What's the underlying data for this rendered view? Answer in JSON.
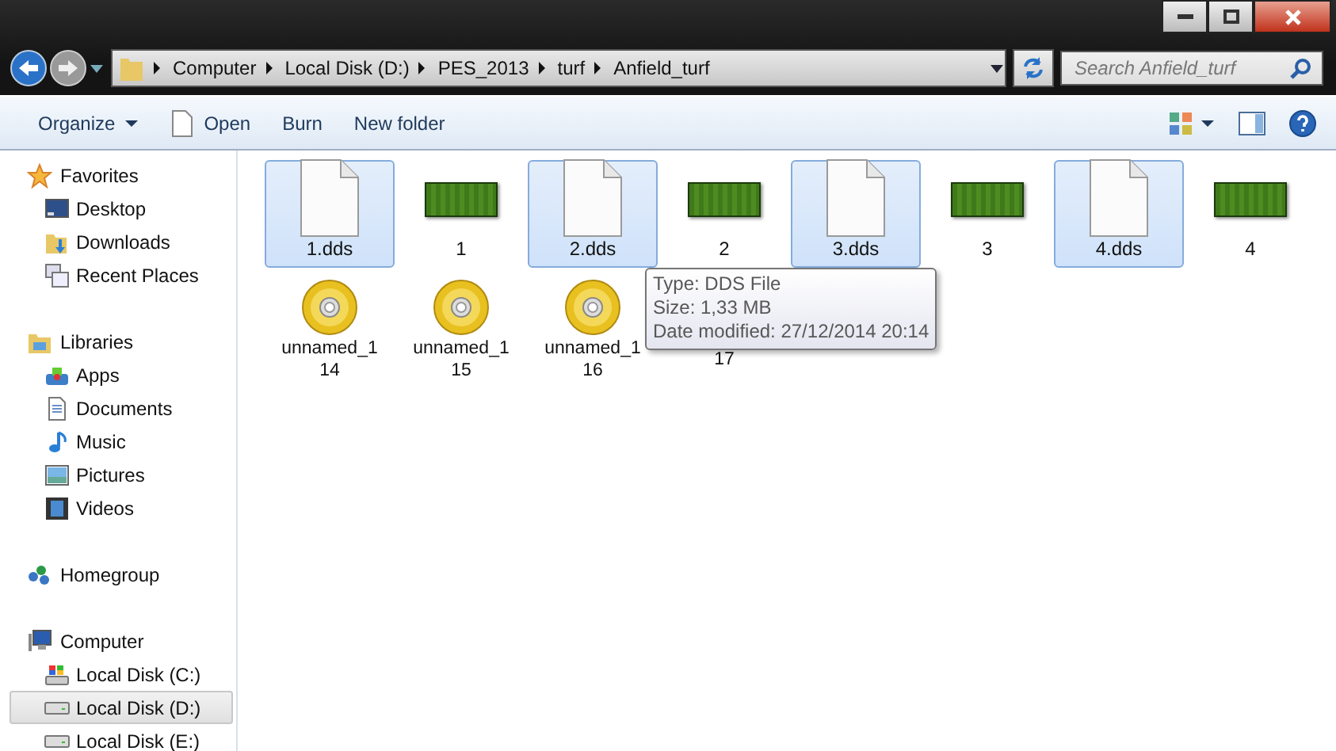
{
  "address": {
    "crumbs": [
      "Computer",
      "Local Disk (D:)",
      "PES_2013",
      "turf",
      "Anfield_turf"
    ]
  },
  "search": {
    "placeholder": "Search Anfield_turf"
  },
  "toolbar": {
    "buttons": [
      {
        "label": "Organize",
        "kind": "menu"
      },
      {
        "label": "Open",
        "kind": "open"
      },
      {
        "label": "Burn",
        "kind": "plain"
      },
      {
        "label": "New folder",
        "kind": "plain"
      }
    ]
  },
  "sidebar": {
    "groups": [
      {
        "label": "Favorites",
        "kind": "star",
        "selected": false,
        "children": [
          {
            "label": "Desktop",
            "kind": "desktop",
            "selected": false
          },
          {
            "label": "Downloads",
            "kind": "downloads",
            "selected": false
          },
          {
            "label": "Recent Places",
            "kind": "recent",
            "selected": false
          }
        ]
      },
      {
        "label": "Libraries",
        "kind": "libraries",
        "selected": false,
        "children": [
          {
            "label": "Apps",
            "kind": "apps",
            "selected": false
          },
          {
            "label": "Documents",
            "kind": "documents",
            "selected": false
          },
          {
            "label": "Music",
            "kind": "music",
            "selected": false
          },
          {
            "label": "Pictures",
            "kind": "pictures",
            "selected": false
          },
          {
            "label": "Videos",
            "kind": "videos",
            "selected": false
          }
        ]
      },
      {
        "label": "Homegroup",
        "kind": "homegroup",
        "selected": false
      },
      {
        "label": "Computer",
        "kind": "computer",
        "selected": false,
        "children": [
          {
            "label": "Local Disk (C:)",
            "kind": "drive-c",
            "selected": false
          },
          {
            "label": "Local Disk (D:)",
            "kind": "drive",
            "selected": true
          },
          {
            "label": "Local Disk (E:)",
            "kind": "drive",
            "selected": false
          }
        ]
      }
    ]
  },
  "files": [
    {
      "lines": [
        "1.dds"
      ],
      "kind": "document",
      "selected": true
    },
    {
      "lines": [
        "1"
      ],
      "kind": "texture",
      "selected": false
    },
    {
      "lines": [
        "2.dds"
      ],
      "kind": "document",
      "selected": true
    },
    {
      "lines": [
        "2"
      ],
      "kind": "texture",
      "selected": false
    },
    {
      "lines": [
        "3.dds"
      ],
      "kind": "document",
      "selected": true
    },
    {
      "lines": [
        "3"
      ],
      "kind": "texture",
      "selected": false
    },
    {
      "lines": [
        "4.dds"
      ],
      "kind": "document",
      "selected": true
    },
    {
      "lines": [
        "4"
      ],
      "kind": "texture",
      "selected": false
    },
    {
      "lines": [
        "unnamed_1",
        "14"
      ],
      "kind": "disc",
      "selected": false
    },
    {
      "lines": [
        "unnamed_1",
        "15"
      ],
      "kind": "disc",
      "selected": false
    },
    {
      "lines": [
        "unnamed_1",
        "16"
      ],
      "kind": "disc",
      "selected": false
    },
    {
      "lines": [
        "17"
      ],
      "selected": false
    }
  ],
  "tooltip": {
    "lines": [
      "Type: DDS File",
      "Size: 1,33 MB",
      "Date modified: 27/12/2014 20:14"
    ]
  }
}
